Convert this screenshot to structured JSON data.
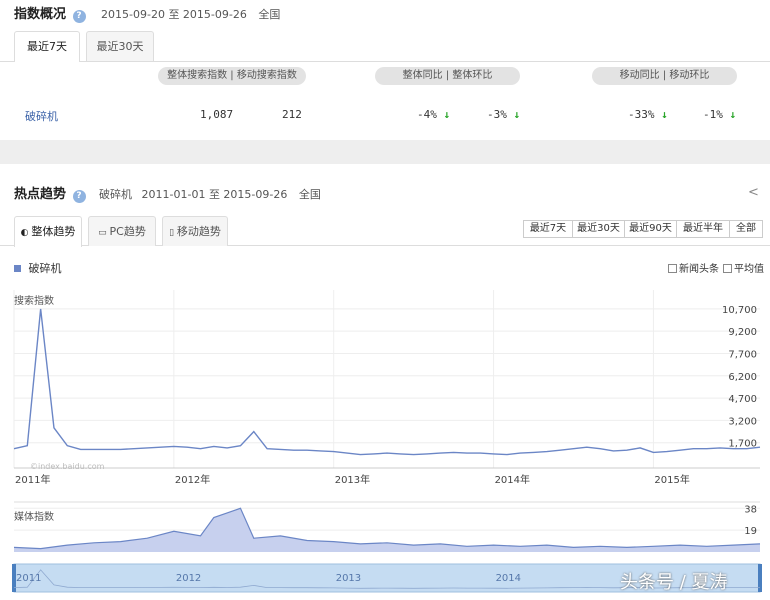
{
  "overview": {
    "title": "指数概况",
    "date_range": "2015-09-20 至 2015-09-26",
    "region": "全国",
    "tabs": [
      "最近7天",
      "最近30天"
    ],
    "group_labels": {
      "total": "整体搜索指数 | 移动搜索指数",
      "overall_compare": "整体同比 | 整体环比",
      "mobile_compare": "移动同比 | 移动环比"
    },
    "keyword": "破碎机",
    "total_index": "1,087",
    "mobile_index": "212",
    "overall_yoy": "-4%",
    "overall_mom": "-3%",
    "mobile_yoy": "-33%",
    "mobile_mom": "-1%"
  },
  "trend": {
    "title": "热点趋势",
    "keyword": "破碎机",
    "date_range": "2011-01-01 至 2015-09-26",
    "region": "全国",
    "tabs": [
      "整体趋势",
      "PC趋势",
      "移动趋势"
    ],
    "ranges": [
      "最近7天",
      "最近30天",
      "最近90天",
      "最近半年",
      "全部"
    ],
    "legend": "破碎机",
    "options": [
      "新闻头条",
      "平均值"
    ],
    "search_label": "搜索指数",
    "media_label": "媒体指数",
    "watermark": "©index.baidu.com",
    "footer_watermark": "头条号 / 夏涛"
  },
  "colors": {
    "line": "#6b86c6",
    "fill": "#c7d0ee",
    "down": "#2aa52a",
    "link": "#3b62a8"
  },
  "chart_data": [
    {
      "type": "line",
      "title": "搜索指数",
      "x": [
        "2011-01",
        "2011-02",
        "2011-03",
        "2011-04",
        "2011-05",
        "2011-06",
        "2011-07",
        "2011-08",
        "2011-09",
        "2011-10",
        "2011-11",
        "2011-12",
        "2012-01",
        "2012-02",
        "2012-03",
        "2012-04",
        "2012-05",
        "2012-06",
        "2012-07",
        "2012-08",
        "2012-09",
        "2012-10",
        "2012-11",
        "2012-12",
        "2013-01",
        "2013-02",
        "2013-03",
        "2013-04",
        "2013-05",
        "2013-06",
        "2013-07",
        "2013-08",
        "2013-09",
        "2013-10",
        "2013-11",
        "2013-12",
        "2014-01",
        "2014-02",
        "2014-03",
        "2014-04",
        "2014-05",
        "2014-06",
        "2014-07",
        "2014-08",
        "2014-09",
        "2014-10",
        "2014-11",
        "2014-12",
        "2015-01",
        "2015-02",
        "2015-03",
        "2015-04",
        "2015-05",
        "2015-06",
        "2015-07",
        "2015-08",
        "2015-09"
      ],
      "values": [
        1300,
        1500,
        10700,
        2700,
        1500,
        1250,
        1250,
        1250,
        1250,
        1300,
        1350,
        1400,
        1450,
        1400,
        1300,
        1450,
        1350,
        1500,
        2450,
        1300,
        1250,
        1200,
        1200,
        1150,
        1100,
        1000,
        900,
        950,
        1000,
        950,
        900,
        950,
        1000,
        1050,
        1000,
        1000,
        950,
        900,
        1000,
        1050,
        1100,
        1200,
        1300,
        1400,
        1300,
        1150,
        1200,
        1350,
        1050,
        1100,
        1200,
        1300,
        1300,
        1350,
        1300,
        1300,
        1400
      ],
      "yticks": [
        1700,
        3200,
        4700,
        6200,
        7700,
        9200,
        10700
      ],
      "xticks": [
        "2011年",
        "2012年",
        "2013年",
        "2014年",
        "2015年"
      ],
      "ylim": [
        0,
        11700
      ]
    },
    {
      "type": "area",
      "title": "媒体指数",
      "x": [
        "2011-01",
        "2011-03",
        "2011-05",
        "2011-07",
        "2011-09",
        "2011-11",
        "2012-01",
        "2012-03",
        "2012-04",
        "2012-05",
        "2012-06",
        "2012-07",
        "2012-09",
        "2012-11",
        "2013-01",
        "2013-03",
        "2013-05",
        "2013-07",
        "2013-09",
        "2013-11",
        "2014-01",
        "2014-03",
        "2014-05",
        "2014-07",
        "2014-09",
        "2014-11",
        "2015-01",
        "2015-03",
        "2015-05",
        "2015-07",
        "2015-09"
      ],
      "values": [
        4,
        3,
        6,
        8,
        9,
        12,
        18,
        14,
        30,
        34,
        38,
        12,
        14,
        10,
        9,
        7,
        8,
        6,
        7,
        5,
        6,
        5,
        6,
        4,
        5,
        4,
        5,
        6,
        5,
        6,
        7
      ],
      "yticks": [
        19,
        38
      ],
      "ylim": [
        0,
        40
      ]
    }
  ],
  "brush_xticks": [
    "2011",
    "2012",
    "2013",
    "2014"
  ]
}
